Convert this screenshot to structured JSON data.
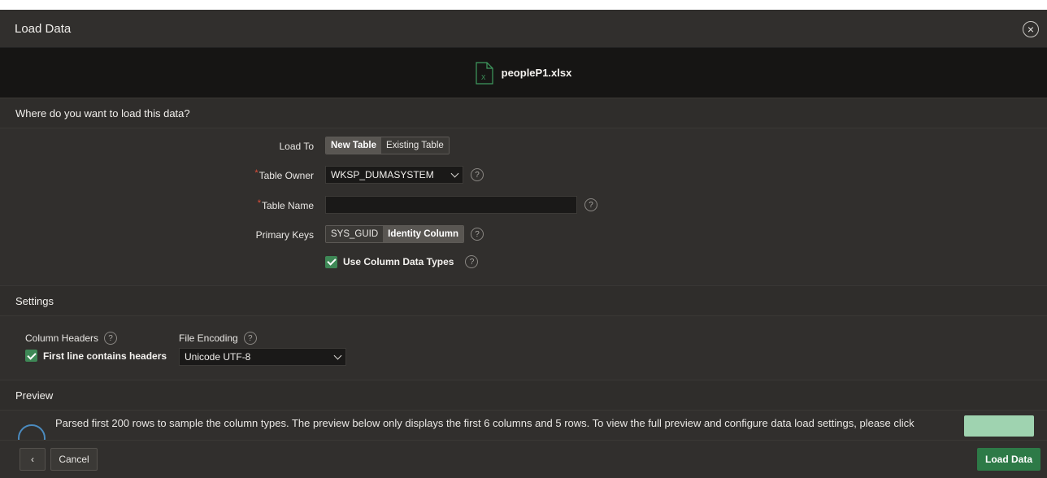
{
  "dialog": {
    "title": "Load Data",
    "close_icon": "close-icon"
  },
  "file": {
    "name": "peopleP1.xlsx",
    "icon": "excel-file-icon"
  },
  "load_section": {
    "heading": "Where do you want to load this data?",
    "load_to": {
      "label": "Load To",
      "options": [
        "New Table",
        "Existing Table"
      ],
      "selected": "New Table"
    },
    "table_owner": {
      "label": "Table Owner",
      "required_mark": "*",
      "value": "WKSP_DUMASYSTEM"
    },
    "table_name": {
      "label": "Table Name",
      "required_mark": "*",
      "value": ""
    },
    "primary_keys": {
      "label": "Primary Keys",
      "options": [
        "SYS_GUID",
        "Identity Column"
      ],
      "selected": "Identity Column"
    },
    "use_column_data_types": {
      "label": "Use Column Data Types",
      "checked": true
    },
    "help_glyph": "?"
  },
  "settings_section": {
    "heading": "Settings",
    "column_headers": {
      "label": "Column Headers",
      "checkbox_label": "First line contains headers",
      "checked": true
    },
    "file_encoding": {
      "label": "File Encoding",
      "value": "Unicode UTF-8"
    }
  },
  "preview_section": {
    "heading": "Preview",
    "message": "Parsed first 200 rows to sample the column types. The preview below only displays the first 6 columns and 5 rows. To view the full preview and configure data load settings, please click"
  },
  "footer": {
    "back_glyph": "‹",
    "cancel_label": "Cancel",
    "load_label": "Load Data"
  },
  "colors": {
    "accent_green": "#2d7a47",
    "required_red": "#e04e39",
    "background": "#312f2d"
  }
}
